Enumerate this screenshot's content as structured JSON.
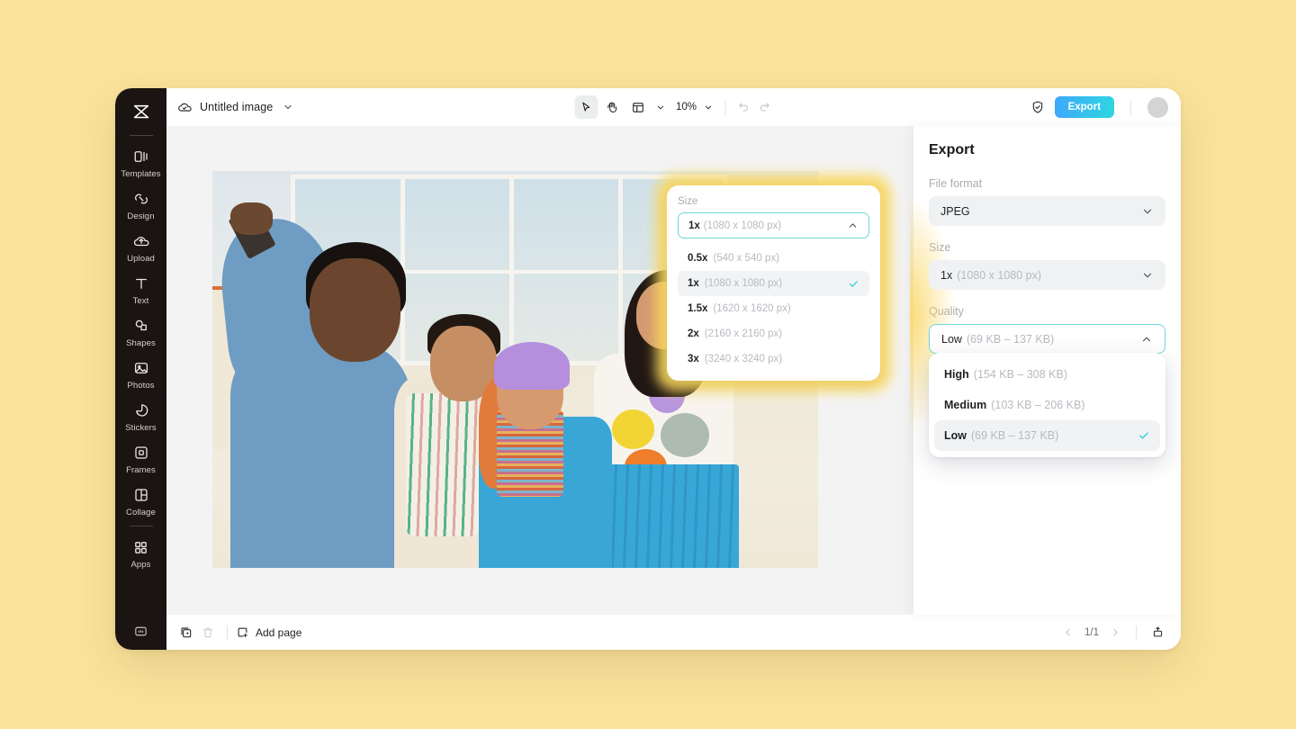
{
  "app": {
    "logo_icon": "capcut-logo-icon",
    "document_title": "Untitled image",
    "cloud_icon": "cloud-sync-icon",
    "title_caret_icon": "chevron-down-icon"
  },
  "sidebar": {
    "items": [
      {
        "label": "Templates",
        "icon": "templates-icon"
      },
      {
        "label": "Design",
        "icon": "design-icon"
      },
      {
        "label": "Upload",
        "icon": "upload-cloud-icon"
      },
      {
        "label": "Text",
        "icon": "text-icon"
      },
      {
        "label": "Shapes",
        "icon": "shapes-icon"
      },
      {
        "label": "Photos",
        "icon": "photos-icon"
      },
      {
        "label": "Stickers",
        "icon": "stickers-icon"
      },
      {
        "label": "Frames",
        "icon": "frames-icon"
      },
      {
        "label": "Collage",
        "icon": "collage-icon"
      },
      {
        "label": "Apps",
        "icon": "apps-grid-icon"
      }
    ],
    "bottom_icon": "help-panel-icon"
  },
  "toolbar": {
    "select_tool_icon": "cursor-arrow-icon",
    "hand_tool_icon": "hand-icon",
    "layout_tool_icon": "layout-panel-icon",
    "layout_caret_icon": "chevron-down-icon",
    "zoom_level": "10%",
    "zoom_caret_icon": "chevron-down-icon",
    "undo_icon": "undo-icon",
    "redo_icon": "redo-icon",
    "shield_icon": "shield-check-icon",
    "export_label": "Export",
    "export_color": "#3ea8fb",
    "avatar_icon": "avatar-icon"
  },
  "bottombar": {
    "duplicate_icon": "duplicate-page-icon",
    "delete_icon": "trash-icon",
    "add_page_icon": "add-page-icon",
    "add_page_label": "Add page",
    "prev_icon": "chevron-left-icon",
    "page_indicator": "1/1",
    "next_icon": "chevron-right-icon",
    "present_icon": "present-icon"
  },
  "export_panel": {
    "title": "Export",
    "file_format": {
      "label": "File format",
      "value": "JPEG",
      "caret_icon": "chevron-down-icon"
    },
    "size": {
      "label": "Size",
      "value_prefix": "1x",
      "value_detail": "(1080 x 1080 px)",
      "caret_icon": "chevron-down-icon"
    },
    "quality": {
      "label": "Quality",
      "value_prefix": "Low",
      "value_detail": "(69 KB – 137 KB)",
      "caret_icon": "chevron-up-icon",
      "options": [
        {
          "name": "High",
          "detail": "(154 KB – 308 KB)",
          "selected": false
        },
        {
          "name": "Medium",
          "detail": "(103 KB – 206 KB)",
          "selected": false
        },
        {
          "name": "Low",
          "detail": "(69 KB – 137 KB)",
          "selected": true
        }
      ],
      "check_icon": "check-icon"
    }
  },
  "size_popup": {
    "label": "Size",
    "value_prefix": "1x",
    "value_detail": "(1080 x 1080 px)",
    "caret_icon": "chevron-up-icon",
    "check_icon": "check-icon",
    "highlight_color": "#fad85f",
    "options": [
      {
        "name": "0.5x",
        "detail": "(540 x 540 px)",
        "selected": false
      },
      {
        "name": "1x",
        "detail": "(1080 x 1080 px)",
        "selected": true
      },
      {
        "name": "1.5x",
        "detail": "(1620 x 1620 px)",
        "selected": false
      },
      {
        "name": "2x",
        "detail": "(2160 x 2160 px)",
        "selected": false
      },
      {
        "name": "3x",
        "detail": "(3240 x 3240 px)",
        "selected": false
      }
    ]
  },
  "canvas": {
    "artwork_name": "group-selfie-photo"
  },
  "page": {
    "background_color": "#fbe39c"
  }
}
